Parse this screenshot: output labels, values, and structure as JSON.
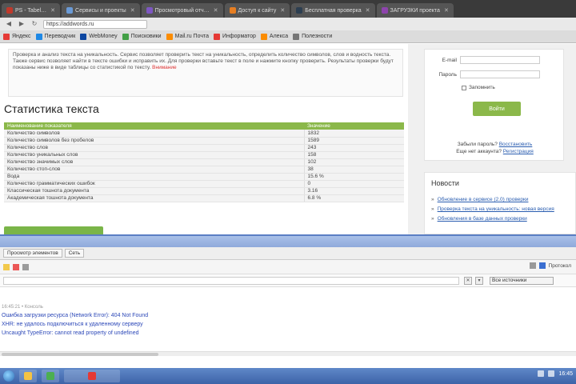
{
  "browser": {
    "tabs": [
      {
        "label": "PS - Tabel…",
        "color": "#c0392b",
        "active": false
      },
      {
        "label": "Сервисы и проекты",
        "color": "#6a9ad6",
        "active": false
      },
      {
        "label": "Просмотровый отч…",
        "color": "#7e57c2",
        "active": false
      },
      {
        "label": "Доступ к сайту",
        "color": "#e67e22",
        "active": false
      },
      {
        "label": "Бесплатная проверка",
        "color": "#2c3e50",
        "active": false
      },
      {
        "label": "ЗАГРУЗКИ проекта",
        "color": "#8e44ad",
        "active": false
      }
    ],
    "url": "https://addwords.ru",
    "bookmarks": [
      {
        "label": "Яндекс",
        "color": "#e53935"
      },
      {
        "label": "Переводчик",
        "color": "#1e88e5"
      },
      {
        "label": "WebMoney",
        "color": "#0d47a1"
      },
      {
        "label": "Поисковики",
        "color": "#43a047"
      },
      {
        "label": "Mail.ru Почта",
        "color": "#fb8c00"
      },
      {
        "label": "Информатор",
        "color": "#e53935"
      },
      {
        "label": "Алекса",
        "color": "#fb8c00"
      },
      {
        "label": "Полезности",
        "color": "#757575"
      }
    ]
  },
  "main": {
    "intro_text": "Проверка и анализ текста на уникальность. Сервис позволяет проверить текст на уникальность, определить количество символов, слов и водность текста. Также сервис позволяет найти в тексте ошибки и исправить их. Для проверки вставьте текст в поле и нажмите кнопку проверить. Результаты проверки будут показаны ниже в виде таблицы со статистикой по тексту.",
    "intro_warn": "Внимание",
    "section_title": "Статистика текста",
    "table_headers": [
      "Наименование показателя",
      "Значение"
    ],
    "table_rows": [
      [
        "Количество символов",
        "1832"
      ],
      [
        "Количество символов без пробелов",
        "1589"
      ],
      [
        "Количество слов",
        "243"
      ],
      [
        "Количество уникальных слов",
        "158"
      ],
      [
        "Количество значимых слов",
        "102"
      ],
      [
        "Количество стоп-слов",
        "38"
      ],
      [
        "Вода",
        "15.6 %"
      ],
      [
        "Количество грамматических ошибок",
        "0"
      ],
      [
        "Классическая тошнота документа",
        "3.16"
      ],
      [
        "Академическая тошнота документа",
        "6.8 %"
      ]
    ]
  },
  "sidebar": {
    "email_label": "E-mail",
    "password_label": "Пароль",
    "remember_label": "Запомнить",
    "login_button": "Войти",
    "forgot_text": "Забыли пароль?",
    "forgot_link": "Восстановить",
    "register_text": "Еще нет аккаунта?",
    "register_link": "Регистрация",
    "news_title": "Новости",
    "news_items": [
      "Обновление в сервисе (2.0) проверки",
      "Проверка текста на уникальность: новая версия",
      "Обновления в базе данных проверки"
    ]
  },
  "devtools": {
    "tabs": [
      "Просмотр элементов",
      "Сеть"
    ],
    "right_label": "Протокол",
    "dropdown": "Все источники",
    "meta": "16:45:21 • Консоль",
    "lines": [
      "Ошибка загрузки ресурса (Network Error): 404 Not Found",
      "XHR: не удалось подключиться к удаленному серверу",
      "Uncaught TypeError: cannot read property of undefined"
    ]
  },
  "colors": {
    "accent": "#8bb84a",
    "link": "#2a5db0",
    "devtools_head": "#8faadb",
    "taskbar": "#3d63a8"
  },
  "taskbar": {
    "apps": [
      {
        "icon": "folder-icon",
        "color": "#f6c343"
      },
      {
        "icon": "browser-icon",
        "color": "#4caf50"
      },
      {
        "icon": "chrome-icon",
        "color": "#e53935"
      }
    ],
    "time": "16:45"
  }
}
